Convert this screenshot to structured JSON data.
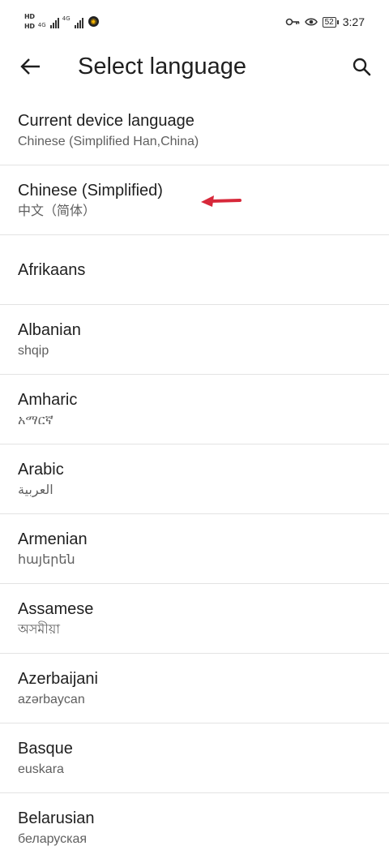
{
  "status_bar": {
    "hd_badge_1": "HD",
    "hd_badge_2": "HD",
    "signal_1_tag": "4G",
    "signal_2_tag": "4G",
    "battery": "52",
    "time": "3:27"
  },
  "app_bar": {
    "title": "Select language"
  },
  "current_device": {
    "label": "Current device language",
    "value": "Chinese (Simplified Han,China)"
  },
  "languages": [
    {
      "name": "Chinese (Simplified)",
      "native": "中文（简体）"
    },
    {
      "name": "Afrikaans",
      "native": ""
    },
    {
      "name": "Albanian",
      "native": "shqip"
    },
    {
      "name": "Amharic",
      "native": "አማርኛ"
    },
    {
      "name": "Arabic",
      "native": "العربية"
    },
    {
      "name": "Armenian",
      "native": "հայերեն"
    },
    {
      "name": "Assamese",
      "native": "অসমীয়া"
    },
    {
      "name": "Azerbaijani",
      "native": "azərbaycan"
    },
    {
      "name": "Basque",
      "native": "euskara"
    },
    {
      "name": "Belarusian",
      "native": "беларуская"
    }
  ],
  "colors": {
    "annotation_arrow": "#d7283a",
    "divider": "#e3e3e3"
  },
  "icons": {
    "back": "arrow-left-icon",
    "search": "search-icon",
    "key": "key-icon",
    "eye": "eye-icon"
  }
}
